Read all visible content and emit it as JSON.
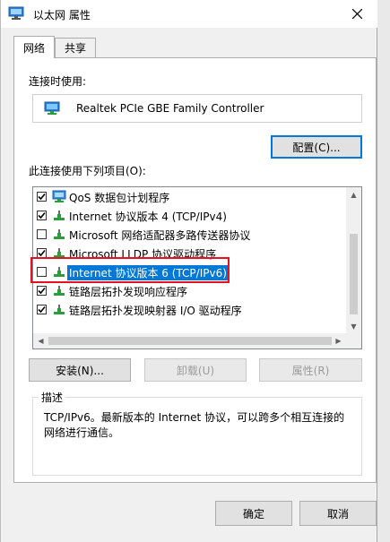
{
  "window": {
    "title": "以太网 属性",
    "colors": {
      "accent": "#0078d7",
      "highlight": "#e81123"
    }
  },
  "tabs": [
    {
      "label": "网络",
      "active": true
    },
    {
      "label": "共享",
      "active": false
    }
  ],
  "connection": {
    "label": "连接时使用:",
    "adapter": "Realtek PCIe GBE Family Controller",
    "configure_label": "配置(C)..."
  },
  "items_section": {
    "label": "此连接使用下列项目(O):",
    "items": [
      {
        "label": "QoS 数据包计划程序",
        "checked": true,
        "icon": "qos-icon"
      },
      {
        "label": "Internet 协议版本 4 (TCP/IPv4)",
        "checked": true,
        "icon": "protocol-icon"
      },
      {
        "label": "Microsoft 网络适配器多路传送器协议",
        "checked": false,
        "icon": "protocol-icon"
      },
      {
        "label": "Microsoft LLDP 协议驱动程序",
        "checked": true,
        "icon": "protocol-icon"
      },
      {
        "label": "Internet 协议版本 6 (TCP/IPv6)",
        "checked": false,
        "icon": "protocol-icon",
        "selected": true
      },
      {
        "label": "链路层拓扑发现响应程序",
        "checked": true,
        "icon": "protocol-icon"
      },
      {
        "label": "链路层拓扑发现映射器 I/O 驱动程序",
        "checked": true,
        "icon": "protocol-icon"
      }
    ]
  },
  "actions": {
    "install": "安装(N)...",
    "uninstall": "卸载(U)",
    "properties": "属性(R)"
  },
  "description": {
    "title": "描述",
    "text": "TCP/IPv6。最新版本的 Internet 协议，可以跨多个相互连接的网络进行通信。"
  },
  "footer": {
    "ok": "确定",
    "cancel": "取消"
  }
}
